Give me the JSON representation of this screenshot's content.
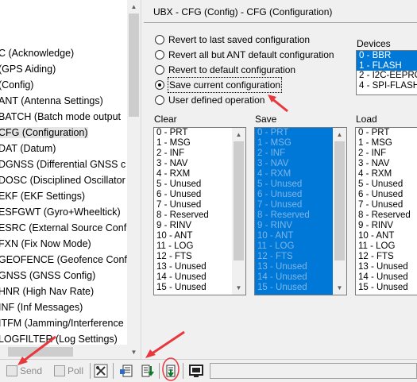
{
  "tree": {
    "items": [
      {
        "label": "C (Acknowledge)"
      },
      {
        "label": "(GPS Aiding)"
      },
      {
        "label": "(Config)"
      },
      {
        "label": "ANT (Antenna Settings)"
      },
      {
        "label": "BATCH (Batch mode output"
      },
      {
        "label": "CFG (Configuration)"
      },
      {
        "label": "DAT (Datum)"
      },
      {
        "label": "DGNSS (Differential GNSS c"
      },
      {
        "label": "DOSC (Disciplined Oscillator"
      },
      {
        "label": "EKF (EKF Settings)"
      },
      {
        "label": "ESFGWT (Gyro+Wheeltick)"
      },
      {
        "label": "ESRC (External Source Confi"
      },
      {
        "label": "FXN (Fix Now Mode)"
      },
      {
        "label": "GEOFENCE (Geofence Confi"
      },
      {
        "label": "GNSS (GNSS Config)"
      },
      {
        "label": "HNR (High Nav Rate)"
      },
      {
        "label": "INF (Inf Messages)"
      },
      {
        "label": "ITFM (Jamming/Interference"
      },
      {
        "label": "LOGFILTER (Log Settings)"
      }
    ],
    "selected_index": 5
  },
  "panel": {
    "title": "UBX - CFG (Config) - CFG (Configuration)",
    "options": [
      {
        "label": "Revert to last saved configuration",
        "checked": false
      },
      {
        "label": "Revert all but ANT default configuration",
        "checked": false
      },
      {
        "label": "Revert to default configuration",
        "checked": false
      },
      {
        "label": "Save current configuration",
        "checked": true
      },
      {
        "label": "User defined operation",
        "checked": false
      }
    ],
    "devices_label": "Devices",
    "devices": [
      {
        "label": "0 - BBR",
        "selected": true
      },
      {
        "label": "1 - FLASH",
        "selected": true
      },
      {
        "label": "2 - I2C-EEPROM",
        "selected": false
      },
      {
        "label": "4 - SPI-FLASH",
        "selected": false
      }
    ],
    "clear_label": "Clear",
    "save_label": "Save",
    "load_label": "Load",
    "items": [
      "0 - PRT",
      "1 - MSG",
      "2 - INF",
      "3 - NAV",
      "4 - RXM",
      "5 - Unused",
      "6 - Unused",
      "7 - Unused",
      "8 - Reserved",
      "9 - RINV",
      "10 - ANT",
      "11 - LOG",
      "12 - FTS",
      "13 - Unused",
      "14 - Unused",
      "15 - Unused"
    ]
  },
  "toolbar": {
    "send_label": "Send",
    "poll_label": "Poll"
  },
  "colors": {
    "selection": "#0078d7",
    "annotation": "#e8383d"
  }
}
